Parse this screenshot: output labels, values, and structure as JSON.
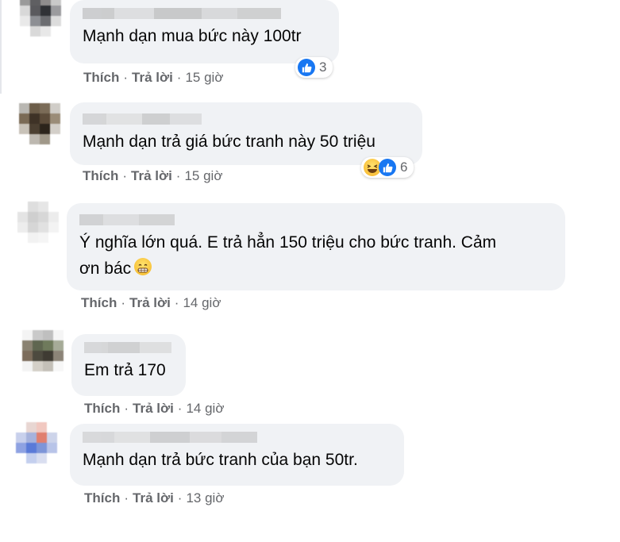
{
  "colors": {
    "bubble": "#f0f2f5",
    "meta": "#65676b",
    "like": "#1877f2"
  },
  "comments": [
    {
      "text": "Mạnh dạn mua bức này 100tr",
      "like": "Thích",
      "reply": "Trả lời",
      "time": "15 giờ",
      "reaction_count": "3",
      "reactions": [
        "like-icon"
      ]
    },
    {
      "text": "Mạnh dạn trả giá bức tranh này 50 triệu",
      "like": "Thích",
      "reply": "Trả lời",
      "time": "15 giờ",
      "reaction_count": "6",
      "reactions": [
        "haha-icon",
        "like-icon"
      ]
    },
    {
      "text": "Ý nghĩa lớn quá. E trả hẳn 150 triệu cho bức tranh. Cảm",
      "text2": "ơn bác",
      "emoji": "grinning-face-icon",
      "like": "Thích",
      "reply": "Trả lời",
      "time": "14 giờ"
    },
    {
      "text": "Em trả 170",
      "like": "Thích",
      "reply": "Trả lời",
      "time": "14 giờ"
    },
    {
      "text": "Mạnh dạn trả bức tranh của bạn 50tr.",
      "like": "Thích",
      "reply": "Trả lời",
      "time": "13 giờ"
    }
  ]
}
